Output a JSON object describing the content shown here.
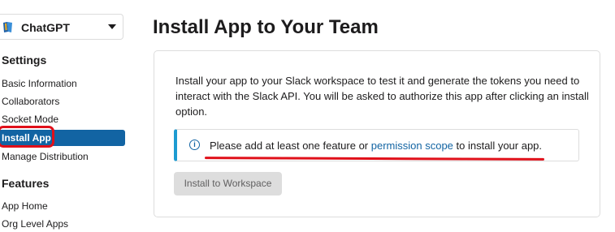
{
  "app_selector": {
    "name": "ChatGPT",
    "icon": "book-icon"
  },
  "sidebar": {
    "settings_title": "Settings",
    "settings_items": [
      {
        "label": "Basic Information"
      },
      {
        "label": "Collaborators"
      },
      {
        "label": "Socket Mode"
      },
      {
        "label": "Install App",
        "active": true
      },
      {
        "label": "Manage Distribution"
      }
    ],
    "features_title": "Features",
    "features_items": [
      {
        "label": "App Home"
      },
      {
        "label": "Org Level Apps"
      }
    ]
  },
  "main": {
    "title": "Install App to Your Team",
    "description": "Install your app to your Slack workspace to test it and generate the tokens you need to interact with the Slack API. You will be asked to authorize this app after clicking an install option.",
    "alert": {
      "icon": "info-icon",
      "text_before": "Please add at least one feature or ",
      "link": "permission scope",
      "text_after": " to install your app."
    },
    "install_button": "Install to Workspace"
  },
  "colors": {
    "accent": "#1264a3",
    "annotation": "#e0101a",
    "alert_border": "#1d9bd1"
  }
}
